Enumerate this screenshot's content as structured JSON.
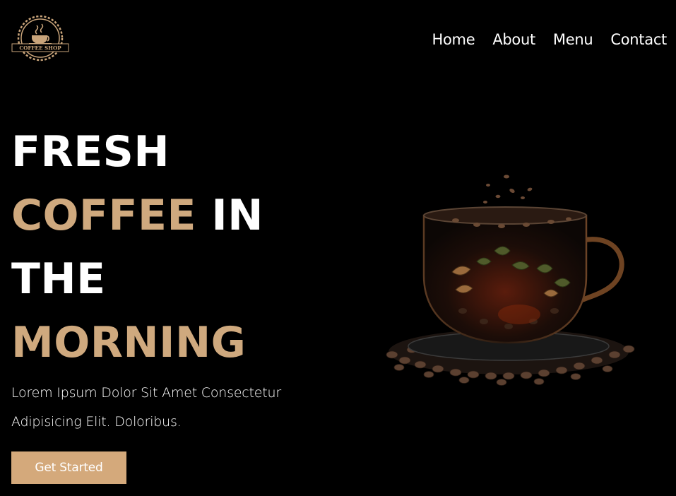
{
  "header": {
    "logo_text": "COFFEE SHOP",
    "nav": [
      "Home",
      "About",
      "Menu",
      "Contact"
    ]
  },
  "hero": {
    "headline": {
      "line1": "FRESH",
      "line2_accent": "COFFEE",
      "line2_rest": "IN",
      "line3": "THE",
      "line4_accent": "MORNING"
    },
    "subtext": "Lorem Ipsum Dolor Sit Amet Consectetur Adipisicing Elit. Doloribus.",
    "cta_label": "Get Started",
    "image_icon": "coffee-cup-with-beans-icon"
  },
  "colors": {
    "background": "#000000",
    "accent": "#cfa97e",
    "button": "#d4a97b",
    "text": "#ffffff"
  }
}
